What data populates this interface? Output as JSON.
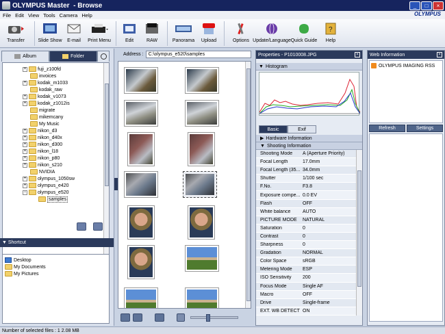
{
  "title": {
    "app": "OLYMPUS Master",
    "mode": "- Browse"
  },
  "menu": [
    "File",
    "Edit",
    "View",
    "Tools",
    "Camera",
    "Help"
  ],
  "brand": "OLYMPUS",
  "toolbar": [
    {
      "label": "Transfer",
      "icon": "camera-transfer-icon"
    },
    {
      "label": "Slide Show",
      "icon": "slideshow-icon"
    },
    {
      "label": "E-mail",
      "icon": "email-icon"
    },
    {
      "label": "Print Menu",
      "icon": "printer-icon"
    },
    {
      "label": "Edit",
      "icon": "edit-icon"
    },
    {
      "label": "RAW",
      "icon": "raw-icon"
    },
    {
      "label": "Panorama",
      "icon": "panorama-icon"
    },
    {
      "label": "Upload",
      "icon": "youtube-upload-icon"
    },
    {
      "label": "Options",
      "icon": "tools-icon"
    },
    {
      "label": "Update/Language",
      "icon": "globe-update-icon"
    },
    {
      "label": "Quick Guide",
      "icon": "quick-guide-icon"
    },
    {
      "label": "Help",
      "icon": "help-book-icon"
    }
  ],
  "left": {
    "tabs": [
      "Album",
      "Folder"
    ],
    "folders": [
      {
        "label": "fuji_z100fd",
        "exp": true
      },
      {
        "label": "invoices",
        "exp": false
      },
      {
        "label": "kodak_m1033",
        "exp": true
      },
      {
        "label": "kodak_raw",
        "exp": false
      },
      {
        "label": "kodak_v1073",
        "exp": true
      },
      {
        "label": "kodak_z1012is",
        "exp": true
      },
      {
        "label": "migrate",
        "exp": false
      },
      {
        "label": "mikemcany",
        "exp": false
      },
      {
        "label": "My Music",
        "exp": false
      },
      {
        "label": "nikon_d3",
        "exp": true
      },
      {
        "label": "nikon_d40x",
        "exp": true
      },
      {
        "label": "nikon_d300",
        "exp": true
      },
      {
        "label": "nikon_l18",
        "exp": true
      },
      {
        "label": "nikon_p80",
        "exp": true
      },
      {
        "label": "nikon_s210",
        "exp": true
      },
      {
        "label": "NVIDIA",
        "exp": false
      },
      {
        "label": "olympus_1050sw",
        "exp": true
      },
      {
        "label": "olympus_e420",
        "exp": true
      },
      {
        "label": "olympus_e520",
        "exp": "open"
      },
      {
        "label": "samples",
        "exp": false,
        "sel": true
      }
    ],
    "shortcut_header": "Shortcut",
    "shortcuts": [
      "Desktop",
      "My Documents",
      "My Pictures"
    ]
  },
  "center": {
    "address_label": "Address :",
    "address": "C:\\olympus_e520\\samples",
    "thumbs": [
      {
        "img": "car-engine",
        "sel": false
      },
      {
        "img": "car-engine",
        "sel": false
      },
      {
        "img": "car-hood",
        "sel": false
      },
      {
        "img": "car-hood",
        "sel": false
      },
      {
        "img": "engine-closeup",
        "sel": false
      },
      {
        "img": "engine-closeup",
        "sel": false
      },
      {
        "img": "engine-bay",
        "sel": false
      },
      {
        "img": "engine-bay",
        "sel": true
      },
      {
        "img": "portrait",
        "sel": false
      },
      {
        "img": "portrait",
        "sel": false
      },
      {
        "img": "portrait",
        "sel": false
      },
      {
        "img": "house",
        "sel": false
      },
      {
        "img": "house",
        "sel": false
      },
      {
        "img": "house",
        "sel": false
      }
    ]
  },
  "props": {
    "header": "Properties - P1010008.JPG",
    "histogram": "Histogram",
    "tabs": [
      "Basic",
      "Exif"
    ],
    "hardware": "Hardware Information",
    "shooting": "Shooting Information",
    "rows": [
      [
        "Shooting Mode",
        "A (Aperture Priority)"
      ],
      [
        "Focal Length",
        "17.0mm"
      ],
      [
        "Focal Length (35...",
        "34.0mm"
      ],
      [
        "Shutter",
        "1/100 sec"
      ],
      [
        "F.No.",
        "F3.8"
      ],
      [
        "Exposure compe...",
        "0.0 EV"
      ],
      [
        "Flash",
        "OFF"
      ],
      [
        "White balance",
        "AUTO"
      ],
      [
        "PICTURE MODE",
        "NATURAL"
      ],
      [
        "Saturation",
        "0"
      ],
      [
        "Contrast",
        "0"
      ],
      [
        "Sharpness",
        "0"
      ],
      [
        "Gradation",
        "NORMAL"
      ],
      [
        "Color Space",
        "sRGB"
      ],
      [
        "Metering Mode",
        "ESP"
      ],
      [
        "ISO Sensitivity",
        "200"
      ],
      [
        "Focus Mode",
        "Single AF"
      ],
      [
        "Macro",
        "OFF"
      ],
      [
        "Drive",
        "Single-frame"
      ],
      [
        "EXT. WB DETECT",
        "ON"
      ]
    ]
  },
  "web": {
    "header": "Web Information",
    "feed": "OLYMPUS IMAGING RSS",
    "refresh": "Refresh",
    "settings": "Settings"
  },
  "status": "Number of selected files : 1   2.08 MB"
}
